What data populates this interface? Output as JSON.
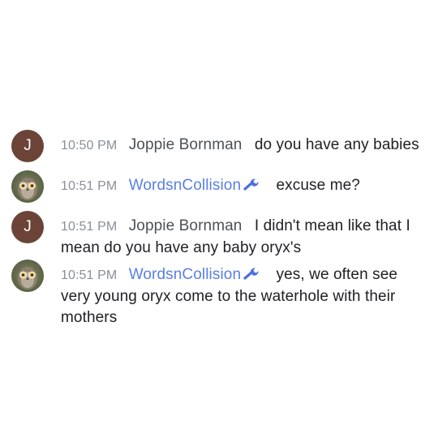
{
  "messages": [
    {
      "time": "10:50 PM",
      "author": "Joppie Bornman",
      "avatar_initial": "J",
      "text": "do you have any babies"
    },
    {
      "time": "10:51 PM",
      "author": "WordsnCollision",
      "avatar_icon": "owl-avatar",
      "badge_icon": "wrench-icon",
      "text": "excuse me?"
    },
    {
      "time": "10:51 PM",
      "author": "Joppie Bornman",
      "avatar_initial": "J",
      "text": "I didn't mean like that I mean do you have any baby oryx's"
    },
    {
      "time": "10:51 PM",
      "author": "WordsnCollision",
      "avatar_icon": "owl-avatar",
      "badge_icon": "wrench-icon",
      "text": "yes, we often see very young oryx come to the waterhole with their mothers"
    }
  ],
  "colors": {
    "moderator_name": "#5a7fe6",
    "user_avatar_bg": "#6b4437",
    "timestamp": "#8a8f98",
    "author_name": "#4d5156"
  }
}
